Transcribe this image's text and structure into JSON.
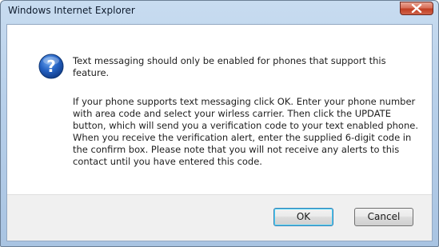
{
  "window": {
    "title": "Windows Internet Explorer",
    "close_icon": "close-icon"
  },
  "dialog": {
    "icon": "question-icon",
    "message_1": "Text messaging should only be enabled for phones that support this feature.",
    "message_2": "If your phone supports text messaging click OK. Enter your phone number with area code and select your wirless carrier. Then click the UPDATE button, which will send you a verification code to your text enabled phone. When you receive the verification alert, enter the supplied 6-digit code in the confirm box. Please note that you will not receive any alerts to this contact until you have entered this code."
  },
  "buttons": {
    "ok_label": "OK",
    "cancel_label": "Cancel"
  },
  "colors": {
    "titlebar": "#b8d0ea",
    "close_button": "#c13e22",
    "icon_blue": "#1f5fb5",
    "footer": "#f0f0f0"
  }
}
